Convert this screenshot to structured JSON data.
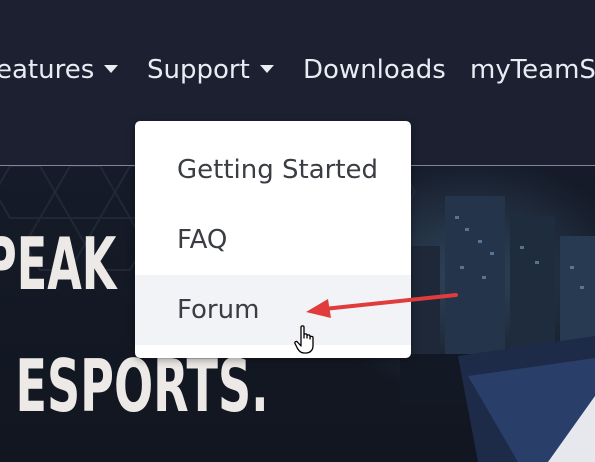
{
  "nav": {
    "items": [
      {
        "label": "Features",
        "shown": "eatures",
        "dropdown": true
      },
      {
        "label": "Support",
        "dropdown": true
      },
      {
        "label": "Downloads",
        "dropdown": false
      },
      {
        "label": "myTeamSp",
        "dropdown": false
      }
    ]
  },
  "dropdown": {
    "open_for": "Support",
    "items": [
      {
        "label": "Getting Started"
      },
      {
        "label": "FAQ"
      },
      {
        "label": "Forum",
        "hovered": true
      }
    ]
  },
  "hero": {
    "line1": "PEAK",
    "line2": "F ESPORTS."
  },
  "annotation": {
    "arrow_color": "#e03c3c",
    "points_to": "Forum"
  },
  "cursor": "hand-pointer-icon"
}
